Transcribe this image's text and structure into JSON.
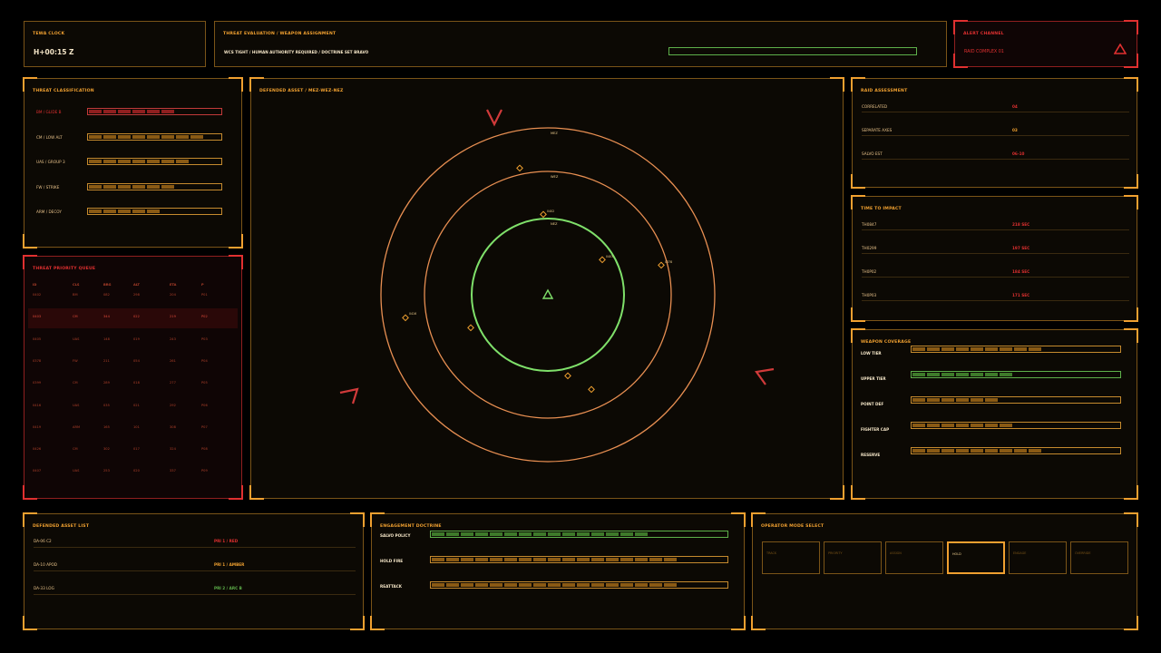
{
  "clock": {
    "title": "TEWA CLOCK",
    "value": "H+00:15 Z"
  },
  "tewa": {
    "title": "THREAT EVALUATION / WEAPON ASSIGNMENT",
    "status": "WCS TIGHT / HUMAN AUTHORITY REQUIRED / DOCTRINE SET BRAVO"
  },
  "alert": {
    "title": "ALERT CHANNEL",
    "message": "RAID COMPLEX 01"
  },
  "classification": {
    "title": "THREAT CLASSIFICATION",
    "rows": [
      {
        "label": "BM / GLIDE B",
        "fill": 0.63,
        "tone": "red"
      },
      {
        "label": "CM / LOW ALT",
        "fill": 0.88,
        "tone": "amber"
      },
      {
        "label": "UAS / GROUP 3",
        "fill": 0.8,
        "tone": "amber"
      },
      {
        "label": "FW / STRIKE",
        "fill": 0.63,
        "tone": "amber"
      },
      {
        "label": "ARM / DECOY",
        "fill": 0.51,
        "tone": "amber"
      }
    ]
  },
  "queue": {
    "title": "THREAT PRIORITY QUEUE",
    "headers": [
      "ID",
      "CLS",
      "BRG",
      "ALT",
      "ETA",
      "P"
    ],
    "rows": [
      [
        "0402",
        "BM",
        "082",
        "298",
        "204",
        "P01"
      ],
      [
        "0403",
        "CM",
        "344",
        "022",
        "219",
        "P02"
      ],
      [
        "0405",
        "UAS",
        "148",
        "019",
        "243",
        "P03"
      ],
      [
        "0378",
        "FW",
        "211",
        "054",
        "261",
        "P04"
      ],
      [
        "0399",
        "CM",
        "289",
        "018",
        "277",
        "P05"
      ],
      [
        "0416",
        "UAS",
        "035",
        "021",
        "292",
        "P06"
      ],
      [
        "0419",
        "ARM",
        "165",
        "101",
        "308",
        "P07"
      ],
      [
        "0426",
        "CM",
        "302",
        "017",
        "324",
        "P08"
      ],
      [
        "0407",
        "UAS",
        "253",
        "020",
        "337",
        "P09"
      ]
    ]
  },
  "radar": {
    "title": "DEFENDED ASSET / MEZ-WEZ-NEZ",
    "rings": [
      "MEZ",
      "WEZ",
      "NEZ"
    ],
    "tracks": [
      "0402",
      "0403",
      "0378",
      "0416"
    ]
  },
  "raid": {
    "title": "RAID ASSESSMENT",
    "rows": [
      {
        "label": "CORRELATED",
        "value": "04"
      },
      {
        "label": "SEPARATE AXES",
        "value": "03"
      },
      {
        "label": "SALVO EST",
        "value": "06-10"
      }
    ]
  },
  "impact": {
    "title": "TIME TO IMPACT",
    "rows": [
      {
        "label": "TH0847",
        "value": "218 SEC"
      },
      {
        "label": "TH0299",
        "value": "197 SEC"
      },
      {
        "label": "TH0P02",
        "value": "184 SEC"
      },
      {
        "label": "TH0P03",
        "value": "171 SEC"
      }
    ]
  },
  "coverage": {
    "title": "WEAPON COVERAGE",
    "rows": [
      {
        "label": "LOW TIER",
        "fill": 0.66,
        "tone": "amber"
      },
      {
        "label": "UPPER TIER",
        "fill": 0.53,
        "tone": "green"
      },
      {
        "label": "POINT DEF",
        "fill": 0.46,
        "tone": "amber"
      },
      {
        "label": "FIGHTER CAP",
        "fill": 0.53,
        "tone": "amber"
      },
      {
        "label": "RESERVE",
        "fill": 0.66,
        "tone": "amber"
      }
    ]
  },
  "assets": {
    "title": "DEFENDED ASSET LIST",
    "rows": [
      {
        "name": "DA-06 C2",
        "priority": "PRI 1 / RED",
        "tone": "red"
      },
      {
        "name": "DA-10 APOD",
        "priority": "PRI 1 / AMBER",
        "tone": "amber"
      },
      {
        "name": "DA-33 LOG",
        "priority": "PRI 2 / ARC B",
        "tone": "green"
      }
    ]
  },
  "doctrine": {
    "title": "ENGAGEMENT DOCTRINE",
    "rows": [
      {
        "label": "SALVO POLICY",
        "fill": 0.75,
        "tone": "green"
      },
      {
        "label": "HOLD FIRE",
        "fill": 0.83,
        "tone": "amber"
      },
      {
        "label": "REATTACK",
        "fill": 0.83,
        "tone": "amber"
      }
    ]
  },
  "modes": {
    "title": "OPERATOR MODE SELECT",
    "items": [
      "TRACK",
      "PRIORITY",
      "ASSIGN",
      "HOLD",
      "ENGAGE",
      "OVERRIDE"
    ],
    "selected": 3
  },
  "colors": {
    "amber": "#f0a030",
    "red": "#e03030",
    "green": "#5eb04a",
    "background": "#0c0904"
  }
}
